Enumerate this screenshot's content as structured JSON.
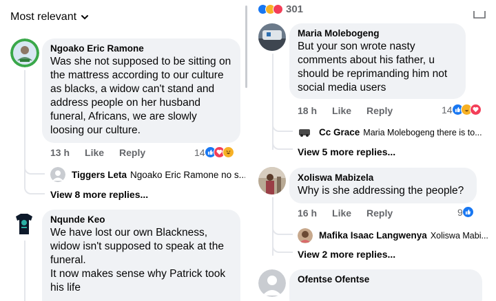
{
  "sort": {
    "label": "Most relevant"
  },
  "left_comments": [
    {
      "name": "Ngoako Eric Ramone",
      "text": "Was she not supposed to be sitting on the mattress according to our culture as blacks, a widow can't stand and address people on her husband funeral, Africans, we are slowly loosing our culture.",
      "time": "13 h",
      "like": "Like",
      "reply": "Reply",
      "reaction_count": "14",
      "reply_preview": {
        "name": "Tiggers Leta",
        "text": "Ngoako Eric Ramone no s..."
      },
      "view_more": "View 8 more replies..."
    },
    {
      "name": "Nqunde Keo",
      "text": "We have lost our own Blackness, widow isn't supposed to speak at the funeral.\nIt now makes sense why Patrick took his life"
    }
  ],
  "right_top": {
    "count": "301"
  },
  "right_comments": [
    {
      "name": "Maria Molebogeng",
      "text": "But your son wrote nasty comments about his father, u should be reprimanding him not social media users",
      "time": "18 h",
      "like": "Like",
      "reply": "Reply",
      "reaction_count": "14",
      "reply_preview": {
        "name": "Cc Grace",
        "text": "Maria Molebogeng there is to..."
      },
      "view_more": "View 5 more replies..."
    },
    {
      "name": "Xoliswa Mabizela",
      "text": "Why is she addressing the people?",
      "time": "16 h",
      "like": "Like",
      "reply": "Reply",
      "reaction_count": "9",
      "reply_preview": {
        "name": "Mafika Isaac Langwenya",
        "text": "Xoliswa Mabi..."
      },
      "view_more": "View 2 more replies..."
    },
    {
      "name": "Ofentse Ofentse"
    }
  ],
  "colors": {
    "like": "#1877f2",
    "love": "#f33e58",
    "haha": "#f7b125",
    "bubble": "#f0f2f5",
    "meta": "#65676b"
  }
}
